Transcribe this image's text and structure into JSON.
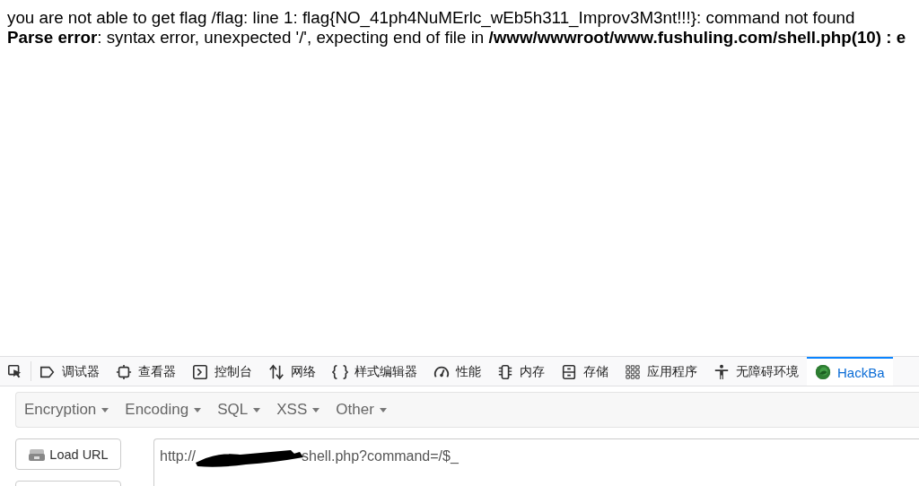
{
  "page": {
    "lines": [
      "you are not able to get flag /flag: line 1: flag{NO_41ph4NuMErlc_wEb5h311_Improv3M3nt!!!}: command not found",
      "**Parse error**: syntax error, unexpected '/', expecting end of file in **/www/wwwroot/www.fushuling.com/shell.php(10) : e**"
    ]
  },
  "devtools": {
    "tabs": [
      {
        "kind": "debugger",
        "label": "调试器",
        "selected": false
      },
      {
        "kind": "inspector",
        "label": "查看器",
        "selected": false
      },
      {
        "kind": "console",
        "label": "控制台",
        "selected": false
      },
      {
        "kind": "network",
        "label": "网络",
        "selected": false
      },
      {
        "kind": "style",
        "label": "样式编辑器",
        "selected": false
      },
      {
        "kind": "performance",
        "label": "性能",
        "selected": false
      },
      {
        "kind": "memory",
        "label": "内存",
        "selected": false
      },
      {
        "kind": "storage",
        "label": "存储",
        "selected": false
      },
      {
        "kind": "application",
        "label": "应用程序",
        "selected": false
      },
      {
        "kind": "accessibility",
        "label": "无障碍环境",
        "selected": false
      },
      {
        "kind": "hackbar",
        "label": "HackBa",
        "selected": true
      }
    ]
  },
  "hackbar": {
    "menu": [
      "Encryption",
      "Encoding",
      "SQL",
      "XSS",
      "Other"
    ],
    "load_button": "Load URL",
    "url": {
      "before_redaction": "http://",
      "after_redaction": "shell.php?command=/$_"
    }
  }
}
